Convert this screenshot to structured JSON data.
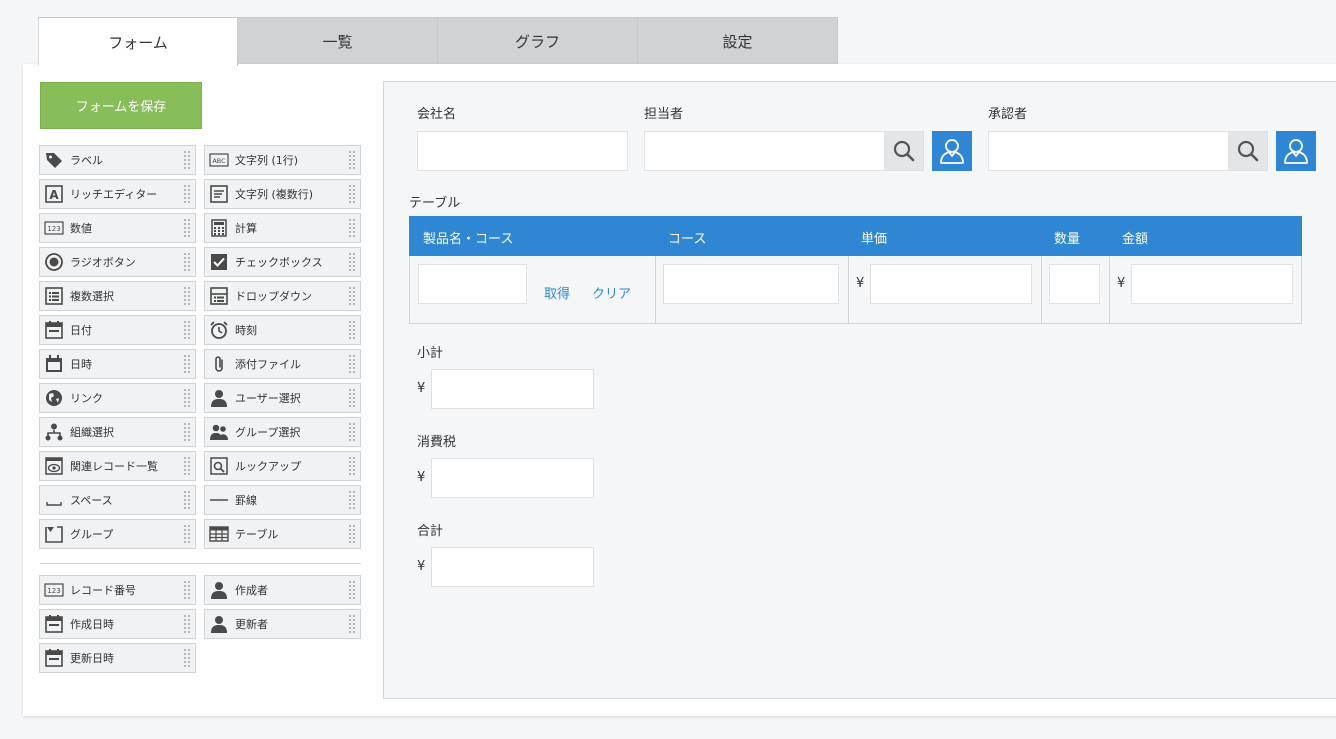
{
  "tabs": [
    "フォーム",
    "一覧",
    "グラフ",
    "設定"
  ],
  "save_button": "フォームを保存",
  "palette": {
    "fields": [
      {
        "label": "ラベル",
        "icon": "tag-icon"
      },
      {
        "label": "文字列 (1行)",
        "icon": "abc-text-icon"
      },
      {
        "label": "リッチエディター",
        "icon": "rich-text-icon"
      },
      {
        "label": "文字列 (複数行)",
        "icon": "multiline-text-icon"
      },
      {
        "label": "数値",
        "icon": "number-123-icon"
      },
      {
        "label": "計算",
        "icon": "calculator-icon"
      },
      {
        "label": "ラジオボタン",
        "icon": "radio-icon"
      },
      {
        "label": "チェックボックス",
        "icon": "checkbox-icon"
      },
      {
        "label": "複数選択",
        "icon": "multi-select-icon"
      },
      {
        "label": "ドロップダウン",
        "icon": "dropdown-icon"
      },
      {
        "label": "日付",
        "icon": "calendar-icon"
      },
      {
        "label": "時刻",
        "icon": "alarm-clock-icon"
      },
      {
        "label": "日時",
        "icon": "calendar-datetime-icon"
      },
      {
        "label": "添付ファイル",
        "icon": "paperclip-icon"
      },
      {
        "label": "リンク",
        "icon": "globe-icon"
      },
      {
        "label": "ユーザー選択",
        "icon": "user-icon"
      },
      {
        "label": "組織選択",
        "icon": "org-chart-icon"
      },
      {
        "label": "グループ選択",
        "icon": "group-icon"
      },
      {
        "label": "関連レコード一覧",
        "icon": "eye-list-icon"
      },
      {
        "label": "ルックアップ",
        "icon": "lookup-icon"
      },
      {
        "label": "スペース",
        "icon": "space-icon"
      },
      {
        "label": "罫線",
        "icon": "horizontal-line-icon"
      },
      {
        "label": "グループ",
        "icon": "group-folder-icon"
      },
      {
        "label": "テーブル",
        "icon": "table-icon"
      }
    ],
    "system_fields": [
      {
        "label": "レコード番号",
        "icon": "number-123-icon"
      },
      {
        "label": "作成者",
        "icon": "user-icon"
      },
      {
        "label": "作成日時",
        "icon": "calendar-icon"
      },
      {
        "label": "更新者",
        "icon": "user-icon"
      },
      {
        "label": "更新日時",
        "icon": "calendar-icon"
      }
    ]
  },
  "form": {
    "company_label": "会社名",
    "assignee_label": "担当者",
    "approver_label": "承認者",
    "table_label": "テーブル",
    "table": {
      "headers": [
        "製品名・コース",
        "コース",
        "単価",
        "数量",
        "金額"
      ],
      "fetch_link": "取得",
      "clear_link": "クリア",
      "currency": "¥"
    },
    "subtotal_label": "小計",
    "tax_label": "消費税",
    "total_label": "合計",
    "currency": "¥"
  },
  "colors": {
    "accent": "#2f87d4",
    "save_green": "#87be5a"
  }
}
